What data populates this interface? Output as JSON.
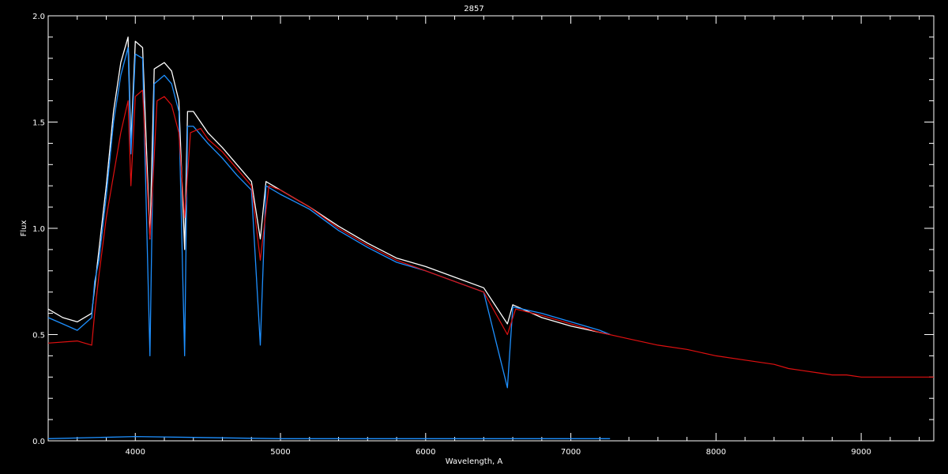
{
  "chart_data": {
    "type": "line",
    "title": "2857",
    "xlabel": "Wavelength, A",
    "ylabel": "Flux",
    "xlim": [
      3400,
      9500
    ],
    "ylim": [
      0.0,
      2.0
    ],
    "x_ticks": [
      "4000",
      "5000",
      "6000",
      "7000",
      "8000",
      "9000"
    ],
    "y_ticks": [
      "0.0",
      "0.5",
      "1.0",
      "1.5",
      "2.0"
    ],
    "grid": false,
    "colors": {
      "background": "#000000",
      "axes": "#ffffff",
      "observed_white": "#ffffff",
      "observed_blue": "#1e90ff",
      "model": "#e01010",
      "error": "#1e90ff"
    },
    "series": [
      {
        "color": "#ffffff",
        "x": [
          3400,
          3500,
          3600,
          3700,
          3750,
          3800,
          3850,
          3900,
          3950,
          3970,
          4000,
          4050,
          4101,
          4130,
          4200,
          4250,
          4300,
          4340,
          4360,
          4400,
          4500,
          4600,
          4700,
          4800,
          4861,
          4900,
          5000,
          5200,
          5400,
          5600,
          5800,
          6000,
          6200,
          6400,
          6563,
          6600,
          6800,
          7000,
          7200,
          7270
        ],
        "y": [
          0.62,
          0.58,
          0.56,
          0.6,
          0.9,
          1.2,
          1.55,
          1.78,
          1.9,
          1.4,
          1.88,
          1.85,
          0.95,
          1.75,
          1.78,
          1.74,
          1.6,
          0.9,
          1.55,
          1.55,
          1.45,
          1.38,
          1.3,
          1.22,
          0.95,
          1.22,
          1.18,
          1.1,
          1.01,
          0.93,
          0.86,
          0.82,
          0.77,
          0.72,
          0.55,
          0.64,
          0.58,
          0.54,
          0.51,
          0.5
        ]
      },
      {
        "color": "#1e90ff",
        "x": [
          3400,
          3500,
          3600,
          3700,
          3720,
          3750,
          3800,
          3850,
          3900,
          3950,
          3970,
          4000,
          4050,
          4101,
          4130,
          4200,
          4250,
          4300,
          4340,
          4360,
          4400,
          4500,
          4600,
          4700,
          4800,
          4861,
          4900,
          5000,
          5200,
          5400,
          5600,
          5800,
          6000,
          6200,
          6400,
          6563,
          6600,
          6800,
          7000,
          7200,
          7270
        ],
        "y": [
          0.58,
          0.55,
          0.52,
          0.58,
          0.75,
          0.85,
          1.15,
          1.5,
          1.72,
          1.85,
          1.35,
          1.82,
          1.8,
          0.4,
          1.68,
          1.72,
          1.68,
          1.55,
          0.4,
          1.48,
          1.48,
          1.4,
          1.33,
          1.25,
          1.18,
          0.45,
          1.2,
          1.16,
          1.09,
          0.99,
          0.91,
          0.84,
          0.8,
          0.75,
          0.7,
          0.25,
          0.63,
          0.6,
          0.56,
          0.52,
          0.5
        ]
      },
      {
        "color": "#e01010",
        "x": [
          3400,
          3600,
          3700,
          3720,
          3750,
          3800,
          3850,
          3900,
          3950,
          3970,
          4000,
          4050,
          4101,
          4150,
          4200,
          4250,
          4300,
          4340,
          4380,
          4450,
          4500,
          4600,
          4700,
          4800,
          4861,
          4920,
          5000,
          5200,
          5400,
          5600,
          5800,
          6000,
          6200,
          6400,
          6563,
          6620,
          6800,
          7000,
          7200,
          7400,
          7600,
          7800,
          8000,
          8200,
          8400,
          8500,
          8600,
          8700,
          8800,
          8900,
          9000,
          9100,
          9200,
          9300,
          9400,
          9500
        ],
        "y": [
          0.46,
          0.47,
          0.45,
          0.6,
          0.78,
          1.05,
          1.25,
          1.45,
          1.6,
          1.2,
          1.62,
          1.65,
          0.95,
          1.6,
          1.62,
          1.58,
          1.45,
          1.05,
          1.45,
          1.47,
          1.42,
          1.36,
          1.28,
          1.2,
          0.85,
          1.2,
          1.18,
          1.1,
          1.0,
          0.92,
          0.85,
          0.8,
          0.75,
          0.7,
          0.5,
          0.62,
          0.59,
          0.55,
          0.51,
          0.48,
          0.45,
          0.43,
          0.4,
          0.38,
          0.36,
          0.34,
          0.33,
          0.32,
          0.31,
          0.31,
          0.3,
          0.3,
          0.3,
          0.3,
          0.3,
          0.3
        ]
      },
      {
        "color": "#1e90ff",
        "x": [
          3400,
          4000,
          5000,
          6000,
          7270
        ],
        "y": [
          0.01,
          0.02,
          0.01,
          0.01,
          0.01
        ]
      }
    ]
  }
}
